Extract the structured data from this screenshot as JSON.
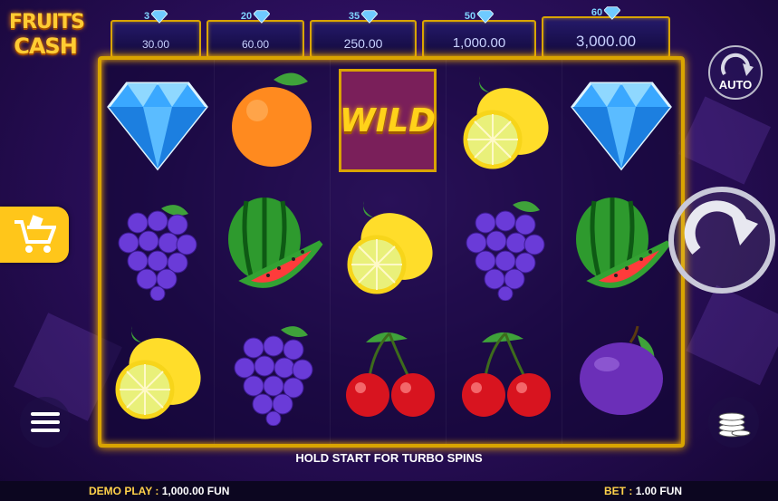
{
  "logo": {
    "line1": "FRUITS",
    "line2": "CASH"
  },
  "jackpots": [
    {
      "count": "3",
      "value": "30.00"
    },
    {
      "count": "20",
      "value": "60.00"
    },
    {
      "count": "35",
      "value": "250.00"
    },
    {
      "count": "50",
      "value": "1,000.00"
    },
    {
      "count": "60",
      "value": "3,000.00"
    }
  ],
  "reels": [
    [
      "diamond",
      "grapes",
      "lemon"
    ],
    [
      "orange",
      "watermelon",
      "grapes"
    ],
    [
      "wild",
      "lemon",
      "cherry"
    ],
    [
      "lemon",
      "grapes",
      "cherry"
    ],
    [
      "diamond",
      "watermelon",
      "plum"
    ]
  ],
  "wild_label": "WILD",
  "buttons": {
    "auto_label": "AUTO"
  },
  "message": "HOLD START FOR TURBO SPINS",
  "footer": {
    "demo_label": "DEMO PLAY :",
    "demo_value": "1,000.00 FUN",
    "bet_label": "BET :",
    "bet_value": "1.00 FUN"
  },
  "colors": {
    "gold": "#d9a400",
    "jackpot_text": "#c9d2ff",
    "footer_label": "#ffd24a"
  }
}
